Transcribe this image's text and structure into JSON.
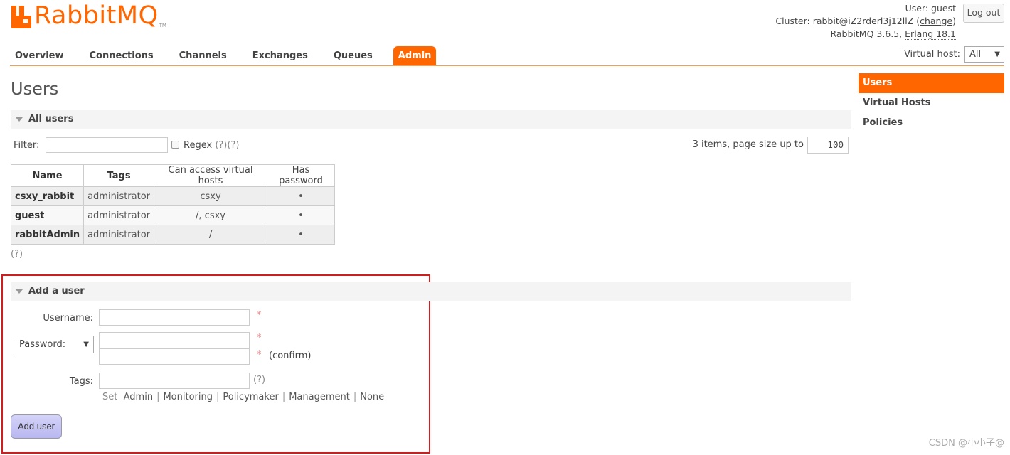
{
  "header": {
    "logo_text": "RabbitMQ",
    "logo_tm": "TM",
    "user_label": "User:",
    "user_name": "guest",
    "cluster_label": "Cluster:",
    "cluster_name": "rabbit@iZ2rderl3j12llZ",
    "change_link": "change",
    "version": "RabbitMQ 3.6.5,",
    "erlang": "Erlang 18.1",
    "logout": "Log out",
    "vhost_label": "Virtual host:",
    "vhost_value": "All",
    "accent_color": "#ff6600"
  },
  "tabs": [
    {
      "label": "Overview",
      "active": false
    },
    {
      "label": "Connections",
      "active": false
    },
    {
      "label": "Channels",
      "active": false
    },
    {
      "label": "Exchanges",
      "active": false
    },
    {
      "label": "Queues",
      "active": false
    },
    {
      "label": "Admin",
      "active": true
    }
  ],
  "side_menu": [
    {
      "label": "Users",
      "active": true
    },
    {
      "label": "Virtual Hosts",
      "active": false
    },
    {
      "label": "Policies",
      "active": false
    }
  ],
  "page_title": "Users",
  "all_users": {
    "section_title": "All users",
    "filter_label": "Filter:",
    "filter_value": "",
    "regex_label": "Regex",
    "regex_help": "(?)(?)",
    "page_info": "3 items, page size up to",
    "page_size": "100",
    "columns": [
      "Name",
      "Tags",
      "Can access virtual hosts",
      "Has password"
    ],
    "rows": [
      {
        "name": "csxy_rabbit",
        "tags": "administrator",
        "vhosts": "csxy",
        "has_password": "•"
      },
      {
        "name": "guest",
        "tags": "administrator",
        "vhosts": "/, csxy",
        "has_password": "•"
      },
      {
        "name": "rabbitAdmin",
        "tags": "administrator",
        "vhosts": "/",
        "has_password": "•"
      }
    ],
    "help": "(?)"
  },
  "add_user": {
    "section_title": "Add a user",
    "username_label": "Username:",
    "username_value": "",
    "password_mode": "Password:",
    "required_mark": "*",
    "confirm_label": "(confirm)",
    "tags_label": "Tags:",
    "tags_help": "(?)",
    "set_label": "Set",
    "tag_options": [
      "Admin",
      "Monitoring",
      "Policymaker",
      "Management",
      "None"
    ],
    "submit": "Add user"
  },
  "watermark": "CSDN @小小子@"
}
